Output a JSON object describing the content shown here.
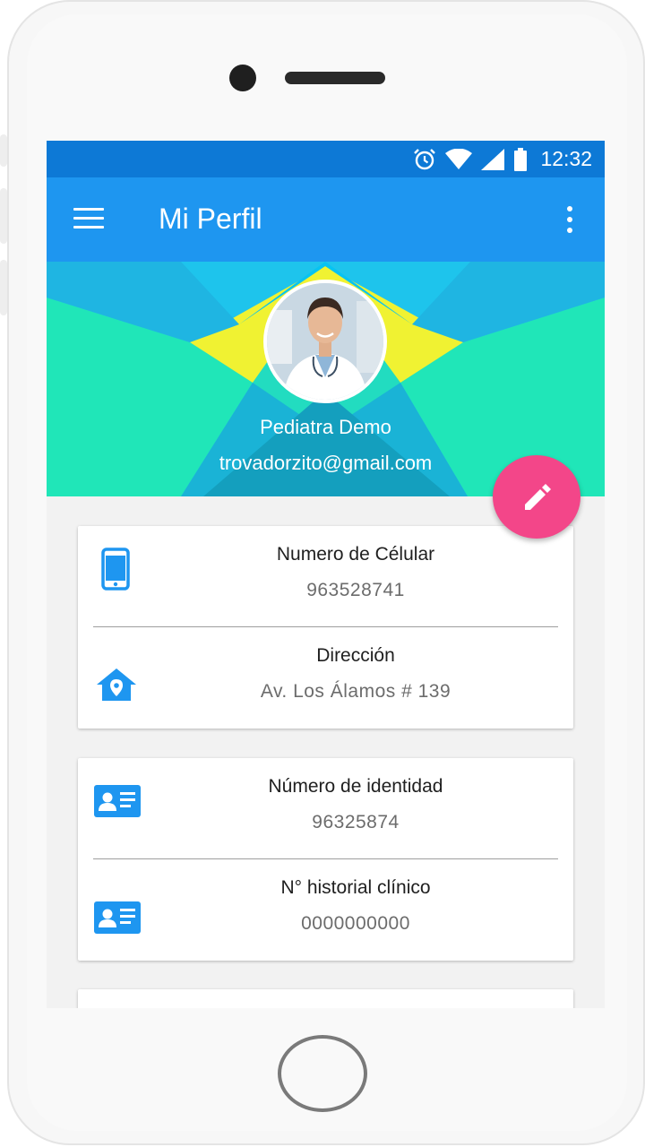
{
  "status_bar": {
    "time": "12:32"
  },
  "app_bar": {
    "title": "Mi Perfil"
  },
  "profile": {
    "name": "Pediatra  Demo",
    "email": "trovadorzito@gmail.com"
  },
  "cards": [
    {
      "rows": [
        {
          "label": "Numero de Célular",
          "value": "963528741",
          "icon": "smartphone-icon"
        },
        {
          "label": "Dirección",
          "value": "Av. Los Álamos # 139",
          "icon": "home-location-icon"
        }
      ]
    },
    {
      "rows": [
        {
          "label": "Número de identidad",
          "value": "96325874",
          "icon": "id-card-icon"
        },
        {
          "label": "N° historial clínico",
          "value": "0000000000",
          "icon": "id-card-icon"
        }
      ]
    }
  ],
  "colors": {
    "status_bar": "#0d79d6",
    "app_bar": "#1e96f0",
    "fab": "#f34689",
    "icon_accent": "#1e96f0"
  }
}
